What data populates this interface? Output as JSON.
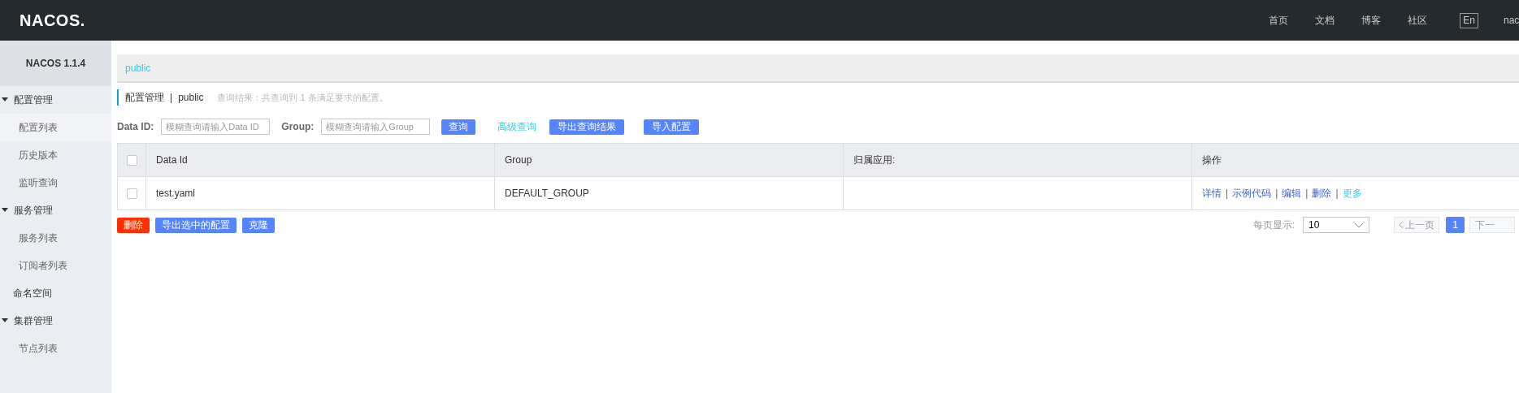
{
  "header": {
    "logo": "NACOS.",
    "nav": [
      "首页",
      "文档",
      "博客",
      "社区"
    ],
    "language": "En",
    "user": "nac"
  },
  "sidebar": {
    "title": "NACOS 1.1.4",
    "items": [
      {
        "label": "配置管理",
        "expanded": true,
        "children": [
          {
            "label": "配置列表",
            "selected": true
          },
          {
            "label": "历史版本",
            "selected": false
          },
          {
            "label": "监听查询",
            "selected": false
          }
        ]
      },
      {
        "label": "服务管理",
        "expanded": true,
        "children": [
          {
            "label": "服务列表",
            "selected": false
          },
          {
            "label": "订阅者列表",
            "selected": false
          }
        ]
      },
      {
        "label": "命名空间"
      },
      {
        "label": "集群管理",
        "expanded": true,
        "children": [
          {
            "label": "节点列表",
            "selected": false
          }
        ]
      }
    ]
  },
  "namespace_bar": {
    "namespace": "public"
  },
  "breadcrumb": {
    "title": "配置管理",
    "separator": "|",
    "namespace": "public",
    "result": "查询结果：共查询到 1 条满足要求的配置。"
  },
  "search": {
    "fields": [
      {
        "label": "Data ID:",
        "placeholder": "模糊查询请输入Data ID"
      },
      {
        "label": "Group:",
        "placeholder": "模糊查询请输入Group"
      }
    ],
    "query_button": "查询",
    "advanced_link": "高级查询",
    "export_button": "导出查询结果",
    "import_button": "导入配置"
  },
  "table": {
    "columns": [
      "Data Id",
      "Group",
      "归属应用:",
      "操作"
    ],
    "header_checked": false,
    "rows": [
      {
        "checked": false,
        "cells": [
          "test.yaml",
          "DEFAULT_GROUP",
          ""
        ],
        "actions": [
          {
            "label": "详情",
            "kind": "link"
          },
          {
            "separator": "|",
            "label": "示例代码",
            "kind": "link"
          },
          {
            "separator": "|",
            "label": "编辑",
            "kind": "link"
          },
          {
            "separator": "|",
            "label": "删除",
            "kind": "link"
          },
          {
            "separator": "|",
            "label": "更多",
            "kind": "more"
          }
        ]
      }
    ]
  },
  "bulk_actions": [
    {
      "label": "删除",
      "kind": "danger"
    },
    {
      "label": "导出选中的配置",
      "kind": "primary"
    },
    {
      "label": "克隆",
      "kind": "primary"
    }
  ],
  "pagination": {
    "page_size_label": "每页显示:",
    "page_size": "10",
    "prev": "上一页",
    "pages": [
      {
        "label": "1",
        "selected": true
      }
    ],
    "next": "下一"
  }
}
